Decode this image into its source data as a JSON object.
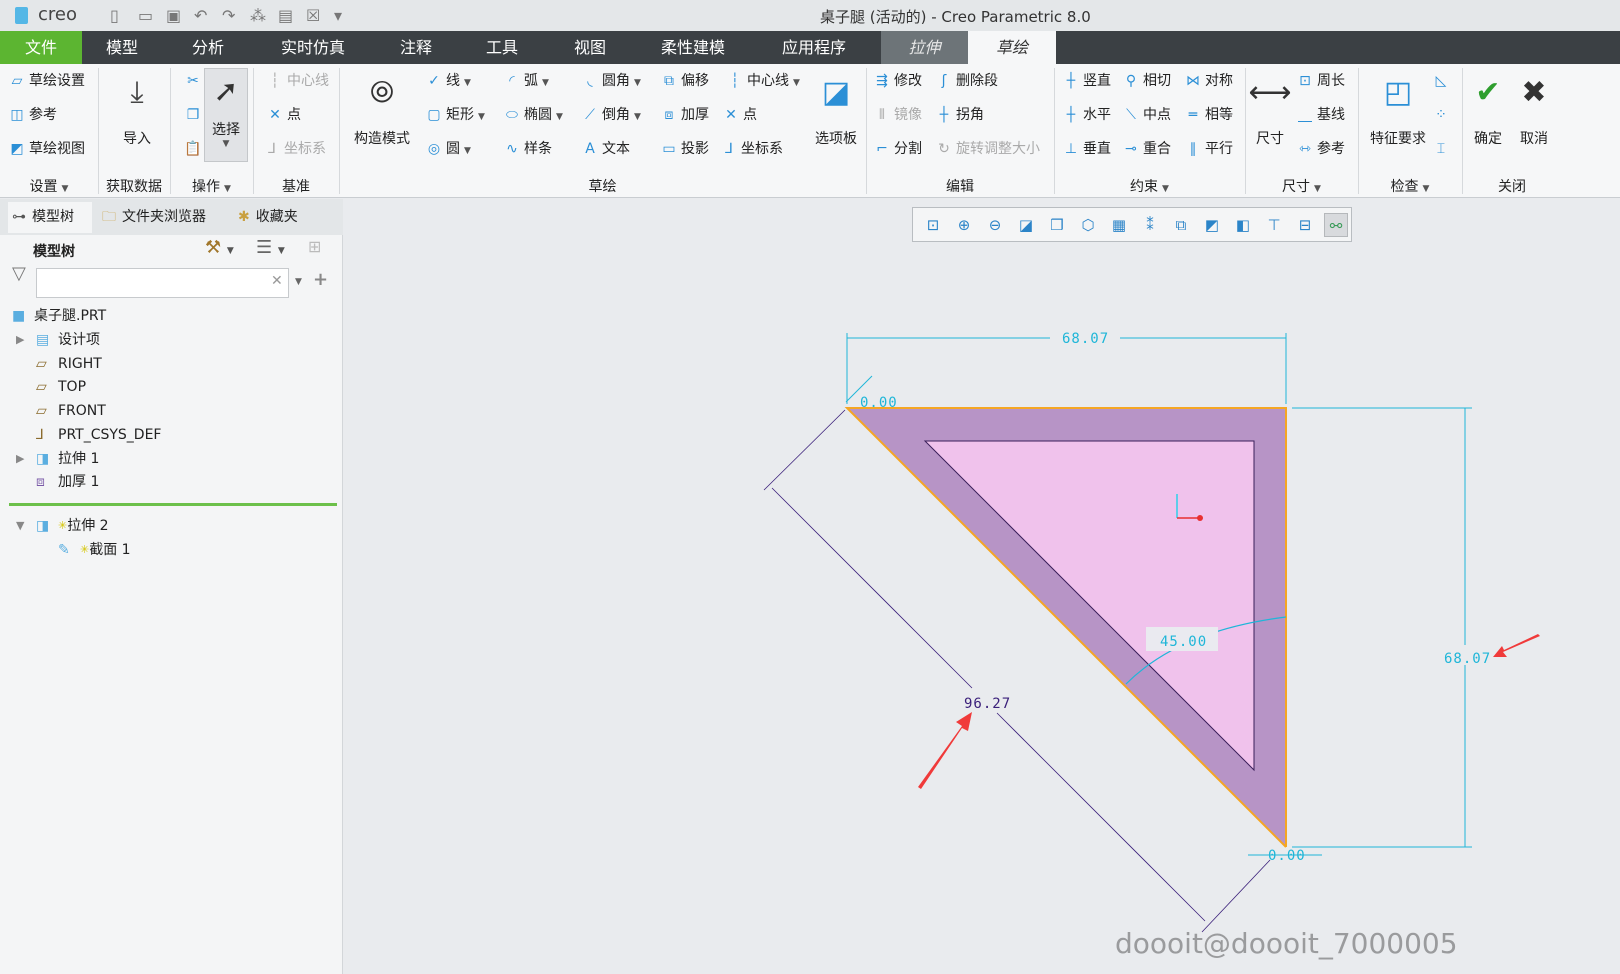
{
  "titlebar": {
    "logo": "creo",
    "title": "桌子腿 (活动的) - Creo Parametric 8.0",
    "quick_icons": [
      "new-icon",
      "open-icon",
      "save-icon",
      "undo-icon",
      "redo-icon",
      "regenerate-icon",
      "windows-icon",
      "close-window-icon",
      "customize-icon"
    ]
  },
  "menu": {
    "tabs": [
      "文件",
      "模型",
      "分析",
      "实时仿真",
      "注释",
      "工具",
      "视图",
      "柔性建模",
      "应用程序",
      "拉伸",
      "草绘"
    ],
    "active": "草绘",
    "file_color": "#5cb531"
  },
  "ribbon": {
    "groups": [
      {
        "label": "设置",
        "dropdown": true,
        "items": [
          {
            "label": "草绘设置",
            "icon": "sketch-setup-icon"
          },
          {
            "label": "参考",
            "icon": "references-icon"
          },
          {
            "label": "草绘视图",
            "icon": "sketch-view-icon"
          }
        ]
      },
      {
        "label": "获取数据",
        "items": [
          {
            "label": "导入",
            "icon": "import-icon",
            "big": true
          }
        ]
      },
      {
        "label": "操作",
        "dropdown": true,
        "items": [
          {
            "label": "",
            "icon": "cut-icon"
          },
          {
            "label": "",
            "icon": "copy-icon"
          },
          {
            "label": "",
            "icon": "paste-icon"
          },
          {
            "label": "选择",
            "icon": "select-arrow-icon",
            "big": true
          }
        ]
      },
      {
        "label": "基准",
        "items": [
          {
            "label": "中心线",
            "icon": "centerline-icon",
            "disabled": true
          },
          {
            "label": "点",
            "icon": "point-icon"
          },
          {
            "label": "坐标系",
            "icon": "csys-icon",
            "disabled": true
          }
        ]
      },
      {
        "label": "草绘",
        "items": [
          {
            "label": "构造模式",
            "icon": "construction-mode-icon",
            "big": true
          },
          {
            "label": "线",
            "icon": "line-icon",
            "dropdown": true
          },
          {
            "label": "矩形",
            "icon": "rectangle-icon",
            "dropdown": true
          },
          {
            "label": "圆",
            "icon": "circle-icon",
            "dropdown": true
          },
          {
            "label": "弧",
            "icon": "arc-icon",
            "dropdown": true
          },
          {
            "label": "椭圆",
            "icon": "ellipse-icon",
            "dropdown": true
          },
          {
            "label": "样条",
            "icon": "spline-icon"
          },
          {
            "label": "圆角",
            "icon": "fillet-icon",
            "dropdown": true
          },
          {
            "label": "倒角",
            "icon": "chamfer-icon",
            "dropdown": true
          },
          {
            "label": "文本",
            "icon": "text-icon"
          },
          {
            "label": "偏移",
            "icon": "offset-icon"
          },
          {
            "label": "加厚",
            "icon": "thicken-icon"
          },
          {
            "label": "投影",
            "icon": "project-icon"
          },
          {
            "label": "中心线",
            "icon": "centerline-icon",
            "dropdown": true
          },
          {
            "label": "点",
            "icon": "point-icon"
          },
          {
            "label": "坐标系",
            "icon": "csys-icon"
          },
          {
            "label": "选项板",
            "icon": "palette-icon",
            "big": true
          }
        ]
      },
      {
        "label": "编辑",
        "items": [
          {
            "label": "修改",
            "icon": "modify-icon"
          },
          {
            "label": "镜像",
            "icon": "mirror-icon",
            "disabled": true
          },
          {
            "label": "分割",
            "icon": "divide-icon"
          },
          {
            "label": "删除段",
            "icon": "delete-segment-icon"
          },
          {
            "label": "拐角",
            "icon": "corner-icon"
          },
          {
            "label": "旋转调整大小",
            "icon": "rotate-resize-icon",
            "disabled": true
          }
        ]
      },
      {
        "label": "约束",
        "dropdown": true,
        "items": [
          {
            "label": "竖直",
            "icon": "vertical-icon"
          },
          {
            "label": "水平",
            "icon": "horizontal-icon"
          },
          {
            "label": "垂直",
            "icon": "perpendicular-icon"
          },
          {
            "label": "相切",
            "icon": "tangent-icon"
          },
          {
            "label": "中点",
            "icon": "midpoint-icon"
          },
          {
            "label": "重合",
            "icon": "coincident-icon"
          },
          {
            "label": "对称",
            "icon": "symmetric-icon"
          },
          {
            "label": "相等",
            "icon": "equal-icon"
          },
          {
            "label": "平行",
            "icon": "parallel-icon"
          }
        ]
      },
      {
        "label": "尺寸",
        "dropdown": true,
        "items": [
          {
            "label": "尺寸",
            "icon": "dimension-icon",
            "big": true
          },
          {
            "label": "周长",
            "icon": "perimeter-icon"
          },
          {
            "label": "基线",
            "icon": "baseline-icon"
          },
          {
            "label": "参考",
            "icon": "reference-dim-icon"
          }
        ]
      },
      {
        "label": "检查",
        "dropdown": true,
        "items": [
          {
            "label": "特征要求",
            "icon": "feature-requirements-icon",
            "big": true
          },
          {
            "label": "",
            "icon": "overlapping-geometry-icon"
          },
          {
            "label": "",
            "icon": "highlight-open-ends-icon"
          },
          {
            "label": "",
            "icon": "shade-closed-loops-icon"
          }
        ]
      },
      {
        "label": "关闭",
        "items": [
          {
            "label": "确定",
            "icon": "ok-check-icon",
            "big": true
          },
          {
            "label": "取消",
            "icon": "cancel-x-icon",
            "big": true
          }
        ]
      }
    ]
  },
  "panel": {
    "tabs": [
      "模型树",
      "文件夹浏览器",
      "收藏夹"
    ],
    "header": "模型树",
    "search": {
      "value": "",
      "placeholder": ""
    },
    "tree": [
      {
        "label": "桌子腿.PRT",
        "icon": "part-icon"
      },
      {
        "label": "设计项",
        "icon": "design-items-icon",
        "expand": "▶"
      },
      {
        "label": "RIGHT",
        "icon": "datum-plane-icon"
      },
      {
        "label": "TOP",
        "icon": "datum-plane-icon"
      },
      {
        "label": "FRONT",
        "icon": "datum-plane-icon"
      },
      {
        "label": "PRT_CSYS_DEF",
        "icon": "csys-icon"
      },
      {
        "label": "拉伸 1",
        "icon": "extrude-icon",
        "expand": "▶"
      },
      {
        "label": "加厚 1",
        "icon": "thicken-icon"
      },
      {
        "label": "拉伸 2",
        "icon": "extrude-icon",
        "expand": "▼",
        "new": true
      },
      {
        "label": "截面 1",
        "icon": "sketch-icon",
        "new": true
      }
    ]
  },
  "viewbar": {
    "icons": [
      "refit-icon",
      "zoom-in-icon",
      "zoom-out-icon",
      "repaint-icon",
      "display-style-icon",
      "saved-orientations-icon",
      "named-views-icon",
      "datum-display-icon",
      "spin-center-icon",
      "sketch-view-icon",
      "annotation-display-icon",
      "dim-display-icon",
      "sketcher-display-icon",
      "constraint-display-icon"
    ]
  },
  "sketch": {
    "dims": {
      "top": "68.07",
      "right": "68.07",
      "diagonal": "96.27",
      "angle": "45.00",
      "zero_top": "0.00",
      "zero_bottom": "0.00"
    },
    "colors": {
      "outer_fill": "#b794c6",
      "inner_fill": "#f0c2ec",
      "edge": "#f5a623",
      "dim": "#1fb6d8",
      "diag_dim": "#3a1f7a",
      "annot_arrow": "#f03a3a"
    }
  },
  "watermark": "doooit@doooit_7000005"
}
